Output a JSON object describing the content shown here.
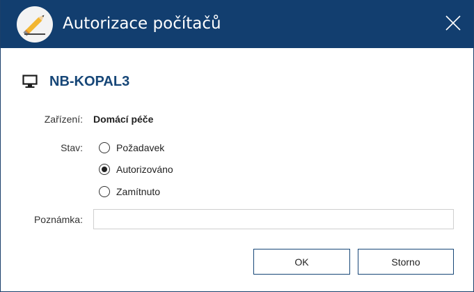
{
  "window": {
    "title": "Autorizace počítačů"
  },
  "icons": {
    "app": "pencil-icon",
    "close": "close-icon",
    "computer": "monitor-icon"
  },
  "computer": {
    "name": "NB-KOPAL3"
  },
  "form": {
    "device_label": "Zařízení:",
    "device_value": "Domácí péče",
    "status_label": "Stav:",
    "status_options": [
      {
        "label": "Požadavek",
        "selected": false
      },
      {
        "label": "Autorizováno",
        "selected": true
      },
      {
        "label": "Zamítnuto",
        "selected": false
      }
    ],
    "note_label": "Poznámka:",
    "note_value": "",
    "note_placeholder": ""
  },
  "buttons": {
    "ok_label": "OK",
    "cancel_label": "Storno"
  },
  "colors": {
    "titlebar": "#123e6f",
    "heading": "#164677",
    "button_border": "#164677",
    "app_icon_bg": "#f3f3f3",
    "pencil_body": "#f2b632"
  }
}
